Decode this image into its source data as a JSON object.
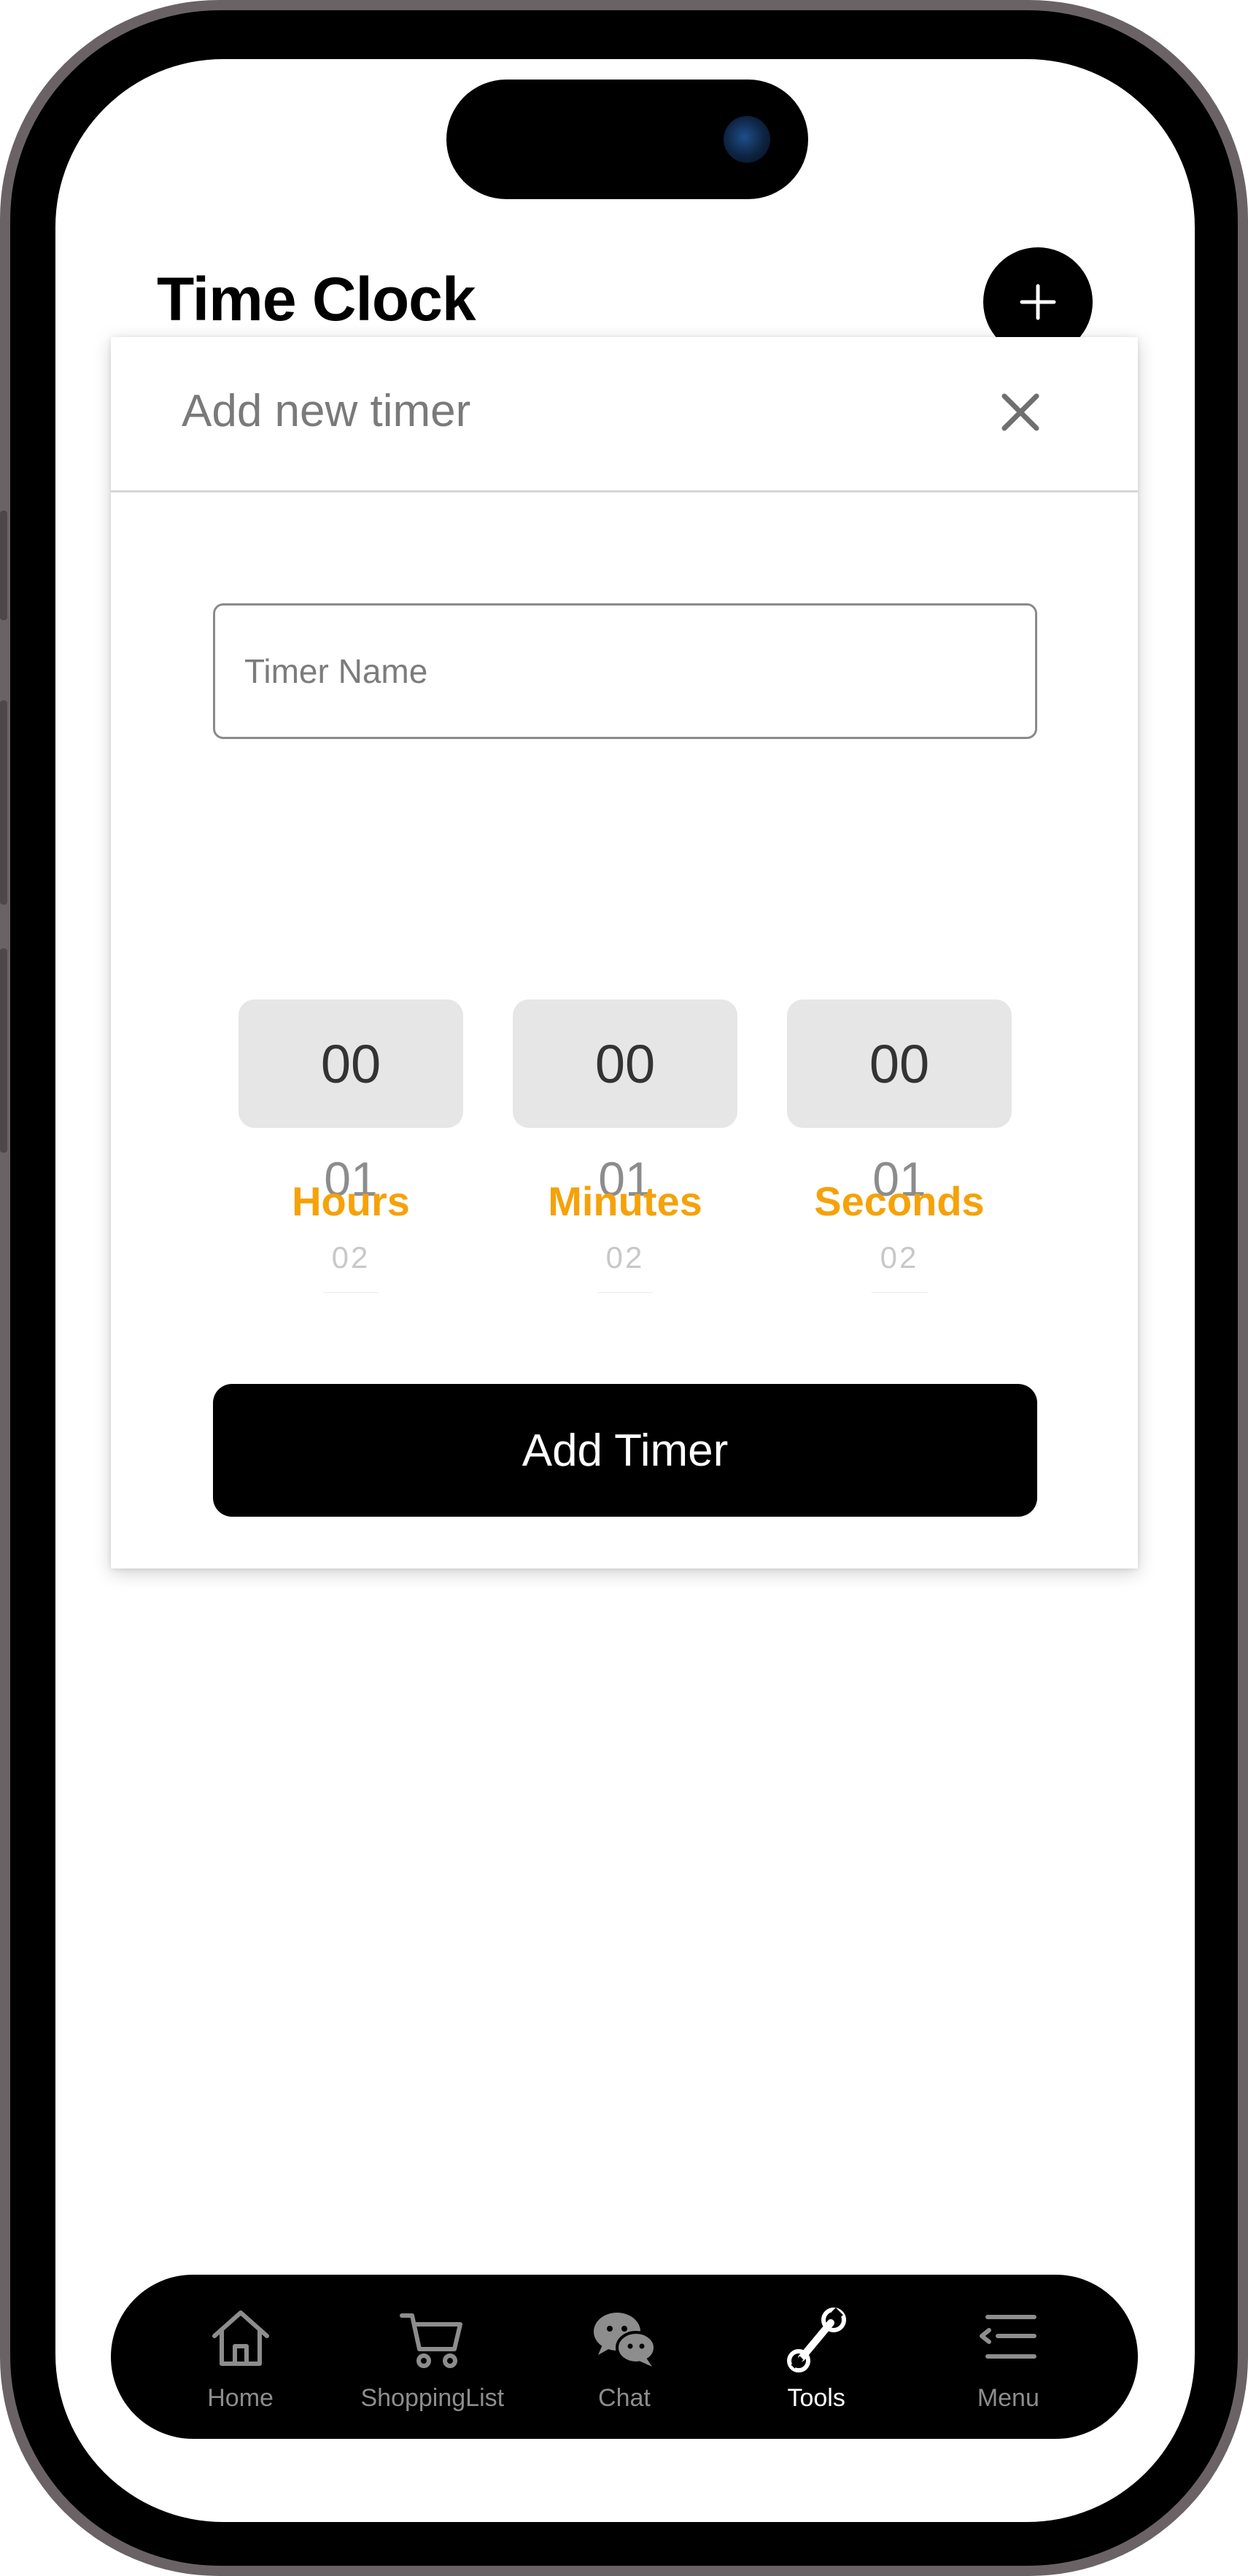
{
  "header": {
    "title": "Time Clock",
    "add_icon": "plus-icon"
  },
  "modal": {
    "title": "Add new timer",
    "close_icon": "close-icon",
    "timer_name": {
      "value": "",
      "placeholder": "Timer Name"
    },
    "pickers": [
      {
        "value": "00",
        "next": "01",
        "next2": "02",
        "label": "Hours"
      },
      {
        "value": "00",
        "next": "01",
        "next2": "02",
        "label": "Minutes"
      },
      {
        "value": "00",
        "next": "01",
        "next2": "02",
        "label": "Seconds"
      }
    ],
    "submit_label": "Add Timer"
  },
  "nav": {
    "items": [
      {
        "label": "Home",
        "icon": "home-icon",
        "active": false
      },
      {
        "label": "ShoppingList",
        "icon": "cart-icon",
        "active": false
      },
      {
        "label": "Chat",
        "icon": "chat-icon",
        "active": false
      },
      {
        "label": "Tools",
        "icon": "tools-icon",
        "active": true
      },
      {
        "label": "Menu",
        "icon": "menu-icon",
        "active": false
      }
    ]
  },
  "colors": {
    "accent": "#f5a20a",
    "primary": "#000000",
    "picker_bg": "#e6e6e6",
    "nav_inactive": "#8d8d8d",
    "nav_active": "#ffffff"
  }
}
